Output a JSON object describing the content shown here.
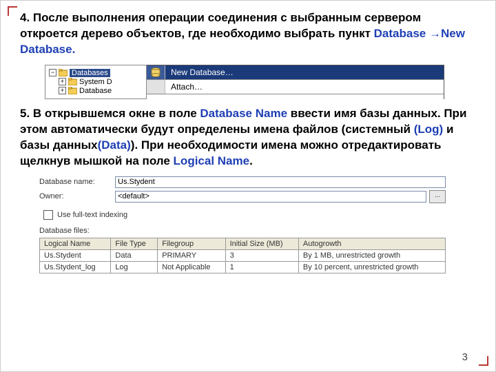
{
  "para4": {
    "prefix": "4. После выполнения операции соединения с выбранным сервером откроется дерево объектов, где необходимо выбрать пункт ",
    "kw1": "Database",
    "arrow": "→",
    "kw2": "New Database."
  },
  "tree": {
    "root": "Databases",
    "child1": "System D",
    "child2": "Database"
  },
  "menu": {
    "item1": "New Database…",
    "item2": "Attach…"
  },
  "para5": {
    "t1": "5. В открывшемся окне в поле ",
    "kw1": "Database Name",
    "t2": " ввести  имя базы данных. При этом автоматически будут определены имена файлов (системный ",
    "kw2": "(Log)",
    "t3": " и базы данных",
    "kw3": "(Data)",
    "t4": "). При необходимости имена можно отредактировать щелкнув мышкой на поле ",
    "kw4": "Logical Name",
    "t5": "."
  },
  "form": {
    "dbname_label": "Database name:",
    "dbname_value": "Us.Stydent",
    "owner_label": "Owner:",
    "owner_value": "<default>",
    "fulltext_label": "Use full-text indexing",
    "files_label": "Database files:",
    "ellipsis": "..."
  },
  "table": {
    "headers": [
      "Logical Name",
      "File Type",
      "Filegroup",
      "Initial Size (MB)",
      "Autogrowth"
    ],
    "rows": [
      [
        "Us.Stydent",
        "Data",
        "PRIMARY",
        "3",
        "By 1 MB, unrestricted growth"
      ],
      [
        "Us.Stydent_log",
        "Log",
        "Not Applicable",
        "1",
        "By 10 percent, unrestricted growth"
      ]
    ]
  },
  "page": "3"
}
